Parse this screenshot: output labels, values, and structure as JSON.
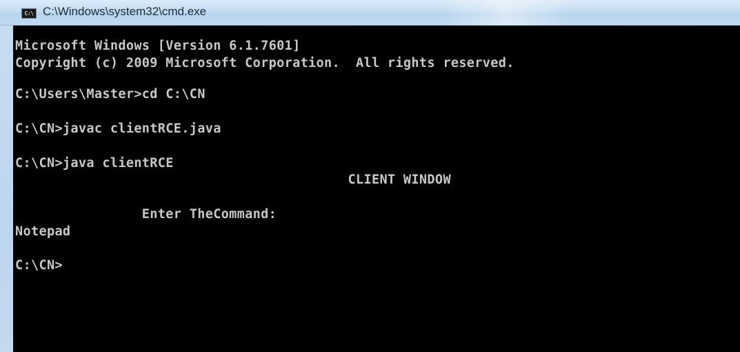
{
  "window": {
    "title": "C:\\Windows\\system32\\cmd.exe",
    "icon": "cmd-console-icon",
    "icon_label": "C:\\"
  },
  "console": {
    "lines": [
      "Microsoft Windows [Version 6.1.7601]",
      "Copyright (c) 2009 Microsoft Corporation.  All rights reserved.",
      "C:\\Users\\Master>cd C:\\CN",
      "C:\\CN>javac clientRCE.java",
      "C:\\CN>java clientRCE",
      "                                          CLIENT WINDOW",
      "                Enter TheCommand:",
      "Notepad",
      "C:\\CN>"
    ]
  },
  "colors": {
    "console_background": "#000000",
    "console_text": "#c8c8c8",
    "titlebar": "#c4dcf2"
  }
}
